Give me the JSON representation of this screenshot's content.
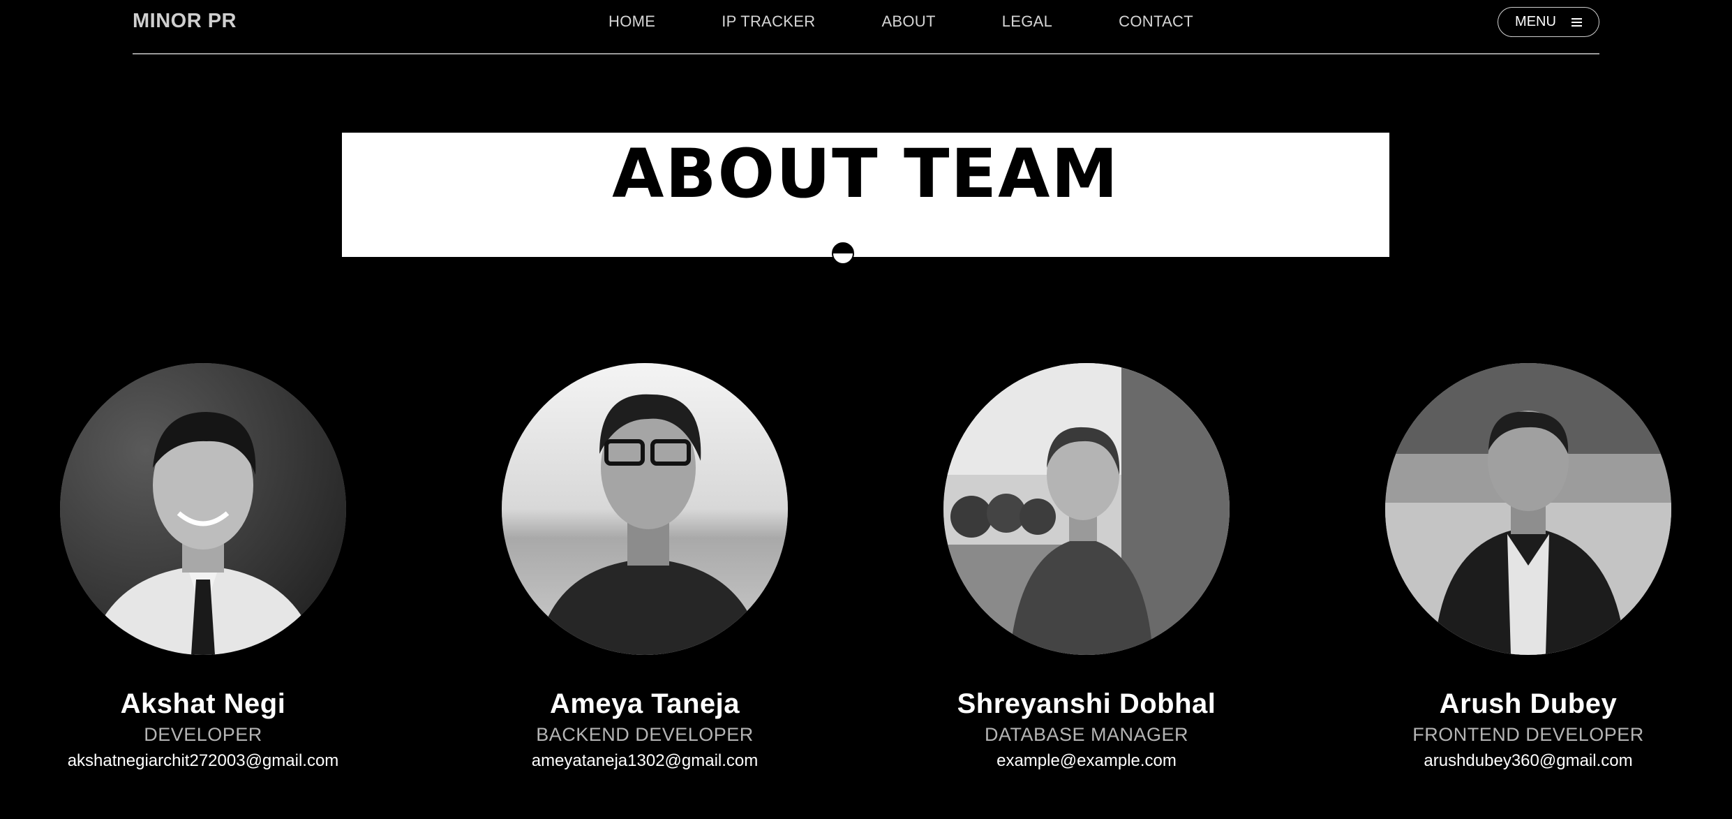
{
  "header": {
    "brand": "MINOR PR",
    "nav": [
      "HOME",
      "IP TRACKER",
      "ABOUT",
      "LEGAL",
      "CONTACT"
    ],
    "menu_label": "MENU",
    "menu_icon": "hamburger-icon"
  },
  "hero": {
    "title": "ABOUT TEAM"
  },
  "team": [
    {
      "name": "Akshat Negi",
      "role": "DEVELOPER",
      "email": "akshatnegiarchit272003@gmail.com"
    },
    {
      "name": "Ameya Taneja",
      "role": "BACKEND DEVELOPER",
      "email": "ameyataneja1302@gmail.com"
    },
    {
      "name": "Shreyanshi Dobhal",
      "role": "DATABASE MANAGER",
      "email": "example@example.com"
    },
    {
      "name": "Arush Dubey",
      "role": "FRONTEND DEVELOPER",
      "email": "arushdubey360@gmail.com"
    }
  ],
  "colors": {
    "background": "#000000",
    "banner": "#ffffff",
    "text": "#ffffff",
    "muted": "#b5b5b5"
  }
}
